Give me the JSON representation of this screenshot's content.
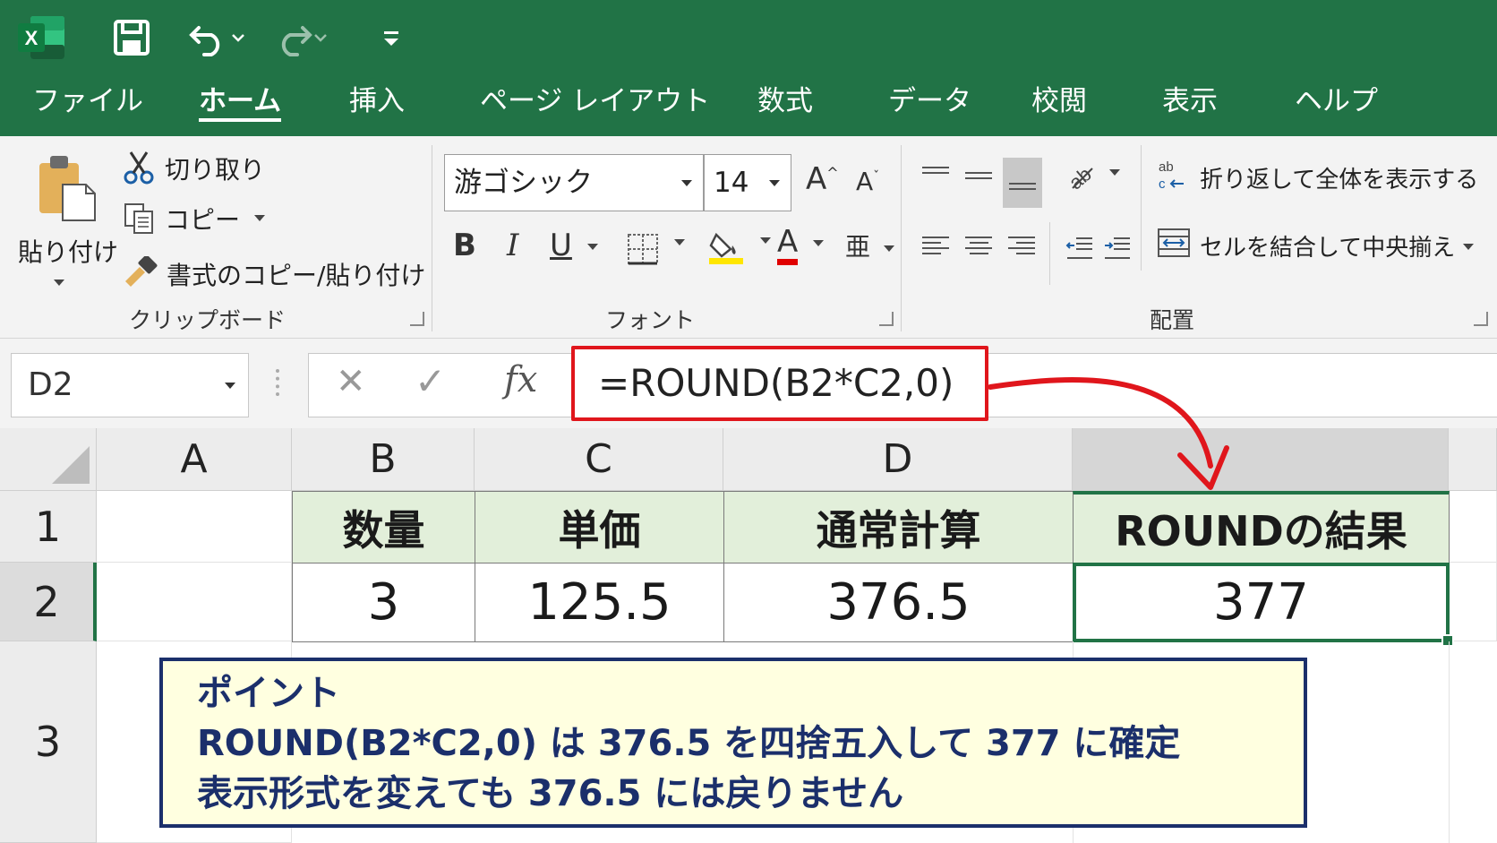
{
  "app": {
    "colors": {
      "excel_green": "#217346",
      "header_fill": "#e2efda",
      "highlight_red": "#e0161c",
      "note_border": "#1b2f6b",
      "note_fill": "#ffffe0"
    },
    "icons": [
      "excel-logo-icon",
      "save-icon",
      "undo-icon",
      "redo-icon",
      "customize-qat-icon"
    ]
  },
  "tabs": [
    "ファイル",
    "ホーム",
    "挿入",
    "ページ レイアウト",
    "数式",
    "データ",
    "校閲",
    "表示",
    "ヘルプ"
  ],
  "ribbon": {
    "clipboard": {
      "paste_label": "貼り付け",
      "cut_label": "切り取り",
      "copy_label": "コピー",
      "format_painter_label": "書式のコピー/貼り付け",
      "group_label": "クリップボード"
    },
    "font": {
      "font_name": "游ゴシック",
      "font_size": "14",
      "bold": "B",
      "italic": "I",
      "underline": "U",
      "grow": "A",
      "shrink": "A",
      "font_color": "A",
      "phonetic": "亜",
      "group_label": "フォント"
    },
    "alignment": {
      "wrap_label": "折り返して全体を表示する",
      "merge_label": "セルを結合して中央揃え",
      "group_label": "配置"
    }
  },
  "formula_bar": {
    "name_box": "D2",
    "cancel": "✕",
    "enter": "✓",
    "fx": "fx",
    "formula": "=ROUND(B2*C2,0)"
  },
  "sheet": {
    "columns": [
      "A",
      "B",
      "C",
      "D"
    ],
    "rows": [
      "1",
      "2",
      "3"
    ],
    "headers": [
      "数量",
      "単価",
      "通常計算",
      "ROUNDの結果"
    ],
    "values": [
      "3",
      "125.5",
      "376.5",
      "377"
    ]
  },
  "note": {
    "title": "ポイント",
    "line1": "ROUND(B2*C2,0) は 376.5 を四捨五入して 377 に確定",
    "line2": "表示形式を変えても 376.5 には戻りません"
  }
}
